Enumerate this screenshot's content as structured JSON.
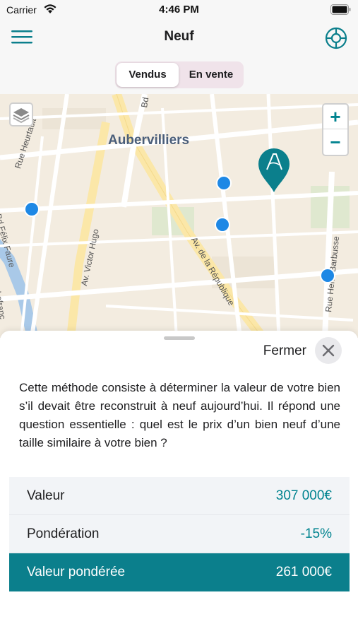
{
  "status": {
    "carrier": "Carrier",
    "time": "4:46 PM"
  },
  "nav": {
    "title": "Neuf",
    "segments": [
      "Vendus",
      "En vente"
    ],
    "selected_segment": "Vendus"
  },
  "icons": {
    "menu": "menu-icon",
    "support": "lifebuoy-icon",
    "layers": "layers-icon",
    "marker": "agency-marker-icon",
    "close": "close-icon"
  },
  "map": {
    "city": "Aubervilliers",
    "streets": [
      "Rue Heurtault",
      "Av. Victor Hugo",
      "Av. de la République",
      "Rue Henri Barbusse",
      "Bd",
      "Bd Félix Faure",
      "Lefranc"
    ],
    "zoom_in": "+",
    "zoom_out": "−"
  },
  "sheet": {
    "close_label": "Fermer",
    "description": "Cette méthode consiste à déterminer la valeur de votre bien s’il devait être reconstruit à neuf aujourd’hui. Il répond une question essentielle : quel est le prix d’un bien neuf d’une taille similaire à votre bien ?",
    "rows": [
      {
        "label": "Valeur",
        "value": "307 000€"
      },
      {
        "label": "Pondération",
        "value": "-15%"
      },
      {
        "label": "Valeur pondérée",
        "value": "261 000€"
      }
    ]
  },
  "colors": {
    "accent": "#0b7f8c",
    "map_dot": "#1e88e5",
    "segment_bg": "#f0e3ea"
  }
}
